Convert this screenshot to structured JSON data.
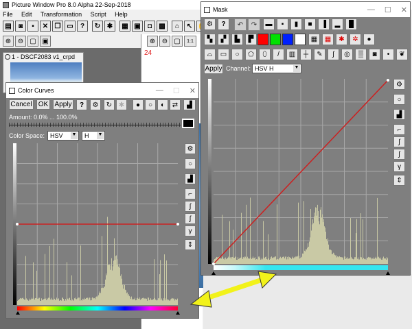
{
  "app": {
    "title": "Picture Window Pro 8.0 Alpha 22-Sep-2018",
    "menu": [
      "File",
      "Edit",
      "Transformation",
      "Script",
      "Help"
    ]
  },
  "doc_window": {
    "title": "1 - DSCF2083 v1_crpd",
    "number_label": "24"
  },
  "color_curves": {
    "title": "Color Curves",
    "cancel_label": "Cancel",
    "ok_label": "OK",
    "apply_label": "Apply",
    "help_label": "?",
    "amount_label": "Amount: 0.0% ... 100.0%",
    "color_space_label": "Color Space:",
    "color_space_value": "HSV",
    "channel_value": "H"
  },
  "mask": {
    "title": "Mask",
    "help_label": "?",
    "apply_label": "Apply",
    "channel_label": "Channel:",
    "channel_value": "HSV H"
  },
  "colors": {
    "curve_red": "#cc2020",
    "histogram": "#c9c9a5",
    "cyan_bar": "#35e6f0",
    "arrow_yellow": "#f2f21a",
    "graph_bg": "#7f7f7f"
  }
}
